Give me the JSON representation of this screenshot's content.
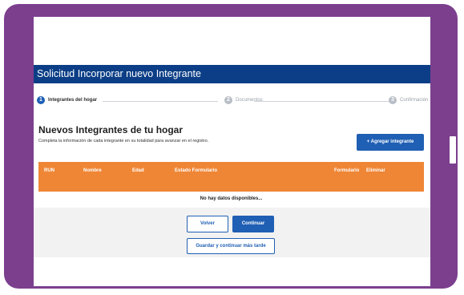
{
  "page": {
    "title": "Solicitud Incorporar nuevo Integrante"
  },
  "stepper": {
    "steps": [
      {
        "number": "1",
        "label": "Integrantes del hogar",
        "state": "active"
      },
      {
        "number": "2",
        "label": "Documentos",
        "state": "inactive"
      },
      {
        "number": "3",
        "label": "Confirmación",
        "state": "inactive"
      }
    ]
  },
  "section": {
    "title": "Nuevos Integrantes de tu hogar",
    "subtitle": "Completa la información de cada integrante en su totalidad para avanzar en el registro.",
    "add_button": "+ Agregar integrante"
  },
  "table": {
    "columns": [
      "RUN",
      "Nombre",
      "Edad",
      "Estado Formulario",
      "Formulario",
      "Eliminar"
    ],
    "empty_message": "No hay datos disponibles..."
  },
  "actions": {
    "back": "Volver",
    "continue": "Continuar",
    "save_later": "Guardar y continuar más tarde"
  },
  "colors": {
    "frame": "#7b3f8e",
    "title_bar": "#0b3e86",
    "primary": "#1f5fb4",
    "table_header": "#ef8636"
  }
}
